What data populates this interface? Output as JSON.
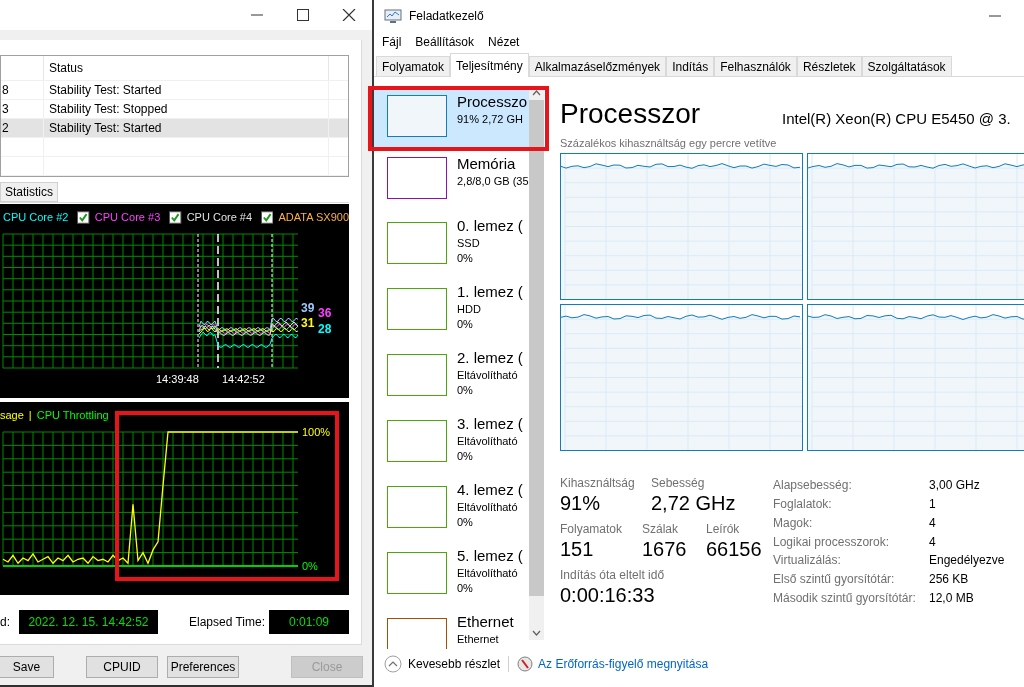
{
  "stability_window": {
    "log_table": {
      "columns": [
        "Status"
      ],
      "rows": [
        {
          "column_1": "8",
          "status": "Stability Test: Started",
          "selected": false
        },
        {
          "column_1": "3",
          "status": "Stability Test: Stopped",
          "selected": false
        },
        {
          "column_1": "2",
          "status": "Stability Test: Started",
          "selected": true
        }
      ]
    },
    "tabs": [
      {
        "label": "Statistics",
        "selected": false
      }
    ],
    "temperature_chart": {
      "legend": [
        {
          "label": "CPU Core #2",
          "color": "#00ffff"
        },
        {
          "label": "CPU Core #3",
          "color": "#ff40ff",
          "checked": true
        },
        {
          "label": "CPU Core #4",
          "color": "#e0e0e0",
          "checked": true
        },
        {
          "label": "ADATA SX900",
          "color": "#ffb040",
          "checked": true
        }
      ],
      "value_labels": [
        {
          "text": "39",
          "color": "#a0c8ff"
        },
        {
          "text": "36",
          "color": "#ff40ff"
        },
        {
          "text": "31",
          "color": "#ffff00"
        },
        {
          "text": "28",
          "color": "#00ffff"
        }
      ],
      "time_labels": [
        "14:39:48",
        "14:42:52"
      ]
    },
    "usage_chart": {
      "separator": "|",
      "chart_data": {
        "type": "line",
        "grid": true,
        "ylim": [
          0,
          100
        ],
        "yticks": [
          {
            "value": 0,
            "label": "0%"
          },
          {
            "value": 100,
            "label": "100%"
          }
        ],
        "series": [
          {
            "name": "sage",
            "color": "#ffff00",
            "values": [
              5,
              3,
              8,
              2,
              6,
              4,
              9,
              3,
              5,
              7,
              2,
              6,
              4,
              8,
              3,
              5,
              6,
              2,
              7,
              4,
              5,
              3,
              8,
              4,
              6,
              2,
              46,
              4,
              10,
              2,
              12,
              18,
              60,
              100,
              100,
              100,
              100,
              100,
              100,
              100,
              100,
              100,
              100,
              100,
              100,
              100,
              100,
              100,
              100,
              100,
              100,
              100,
              100,
              100,
              100,
              100,
              100,
              100,
              100,
              100
            ]
          },
          {
            "name": "CPU Throttling",
            "color": "#00ff00",
            "values": [
              0,
              0,
              0,
              0,
              0,
              0,
              0,
              0,
              0,
              0,
              0,
              0,
              0,
              0,
              0,
              0,
              0,
              0,
              0,
              0,
              0,
              0,
              0,
              0,
              0,
              0,
              0,
              0,
              0,
              0,
              0,
              0,
              0,
              0,
              0,
              0,
              0,
              0,
              0,
              0,
              0,
              0,
              0,
              0,
              0,
              0,
              0,
              0,
              0,
              0,
              0,
              0,
              0,
              0,
              0,
              0,
              0,
              0,
              0,
              0
            ]
          }
        ]
      }
    },
    "start_label": "d:",
    "start_value": "2022. 12. 15. 14:42:52",
    "elapsed_label": "Elapsed Time:",
    "elapsed_value": "0:01:09",
    "buttons": [
      {
        "label": "Save",
        "disabled": false
      },
      {
        "label": "CPUID",
        "disabled": false
      },
      {
        "label": "Preferences",
        "disabled": false
      },
      {
        "label": "Close",
        "disabled": true
      }
    ]
  },
  "task_manager": {
    "title": "Feladatkezelő",
    "menu": [
      "Fájl",
      "Beállítások",
      "Nézet"
    ],
    "tabs": [
      {
        "label": "Folyamatok",
        "selected": false
      },
      {
        "label": "Teljesítmény",
        "selected": true
      },
      {
        "label": "Alkalmazáselőzmények",
        "selected": false
      },
      {
        "label": "Indítás",
        "selected": false
      },
      {
        "label": "Felhasználók",
        "selected": false
      },
      {
        "label": "Részletek",
        "selected": false
      },
      {
        "label": "Szolgáltatások",
        "selected": false
      }
    ],
    "sidebar": {
      "items": [
        {
          "title": "Processzo",
          "lines": [
            "91% 2,72 GH"
          ],
          "color": "#117dbb",
          "selected": true
        },
        {
          "title": "Memória",
          "lines": [
            "2,8/8,0 GB (35"
          ],
          "color": "#8b12ae",
          "selected": false
        },
        {
          "title": "0. lemez (",
          "lines": [
            "SSD",
            "0%"
          ],
          "color": "#4da60c",
          "selected": false
        },
        {
          "title": "1. lemez (",
          "lines": [
            "HDD",
            "0%"
          ],
          "color": "#4da60c",
          "selected": false
        },
        {
          "title": "2. lemez (",
          "lines": [
            "Eltávolítható",
            "0%"
          ],
          "color": "#4da60c",
          "selected": false
        },
        {
          "title": "3. lemez (",
          "lines": [
            "Eltávolítható",
            "0%"
          ],
          "color": "#4da60c",
          "selected": false
        },
        {
          "title": "4. lemez (",
          "lines": [
            "Eltávolítható",
            "0%"
          ],
          "color": "#4da60c",
          "selected": false
        },
        {
          "title": "5. lemez (",
          "lines": [
            "Eltávolítható",
            "0%"
          ],
          "color": "#4da60c",
          "selected": false
        },
        {
          "title": "Ethernet",
          "lines": [
            "Ethernet"
          ],
          "color": "#a74f01",
          "selected": false
        }
      ]
    },
    "heading": "Processzor",
    "cpu_name": "Intel(R) Xeon(R) CPU E5450 @ 3.",
    "graph_caption": "Százalékos kihasználtság egy percre vetítve",
    "core_graphs": [
      {
        "kind": "sparkline"
      },
      {
        "kind": "sparkline"
      },
      {
        "kind": "sparkline"
      },
      {
        "kind": "sparkline"
      }
    ],
    "stat_rows": [
      {
        "items": [
          {
            "label": "Kihasználtság",
            "value": "91%"
          },
          {
            "label": "Sebesség",
            "value": "2,72 GHz"
          }
        ]
      },
      {
        "items": [
          {
            "label": "Folyamatok",
            "value": "151"
          },
          {
            "label": "Szálak",
            "value": "1676"
          },
          {
            "label": "Leírók",
            "value": "66156"
          }
        ]
      },
      {
        "items": [
          {
            "label": "Indítás óta eltelt idő",
            "value": "0:00:16:33"
          }
        ]
      }
    ],
    "details": [
      {
        "label": "Alapsebesség:",
        "value": "3,00 GHz"
      },
      {
        "label": "Foglalatok:",
        "value": "1"
      },
      {
        "label": "Magok:",
        "value": "4"
      },
      {
        "label": "Logikai processzorok:",
        "value": "4"
      },
      {
        "label": "Virtualizálás:",
        "value": "Engedélyezve"
      },
      {
        "label": "Első szintű gyorsítótár:",
        "value": "256 KB"
      },
      {
        "label": "Második szintű gyorsítótár:",
        "value": "12,0 MB"
      }
    ],
    "footer": {
      "less_details": "Kevesebb részlet",
      "link": "Az Erőforrás-figyelő megnyitása"
    }
  }
}
